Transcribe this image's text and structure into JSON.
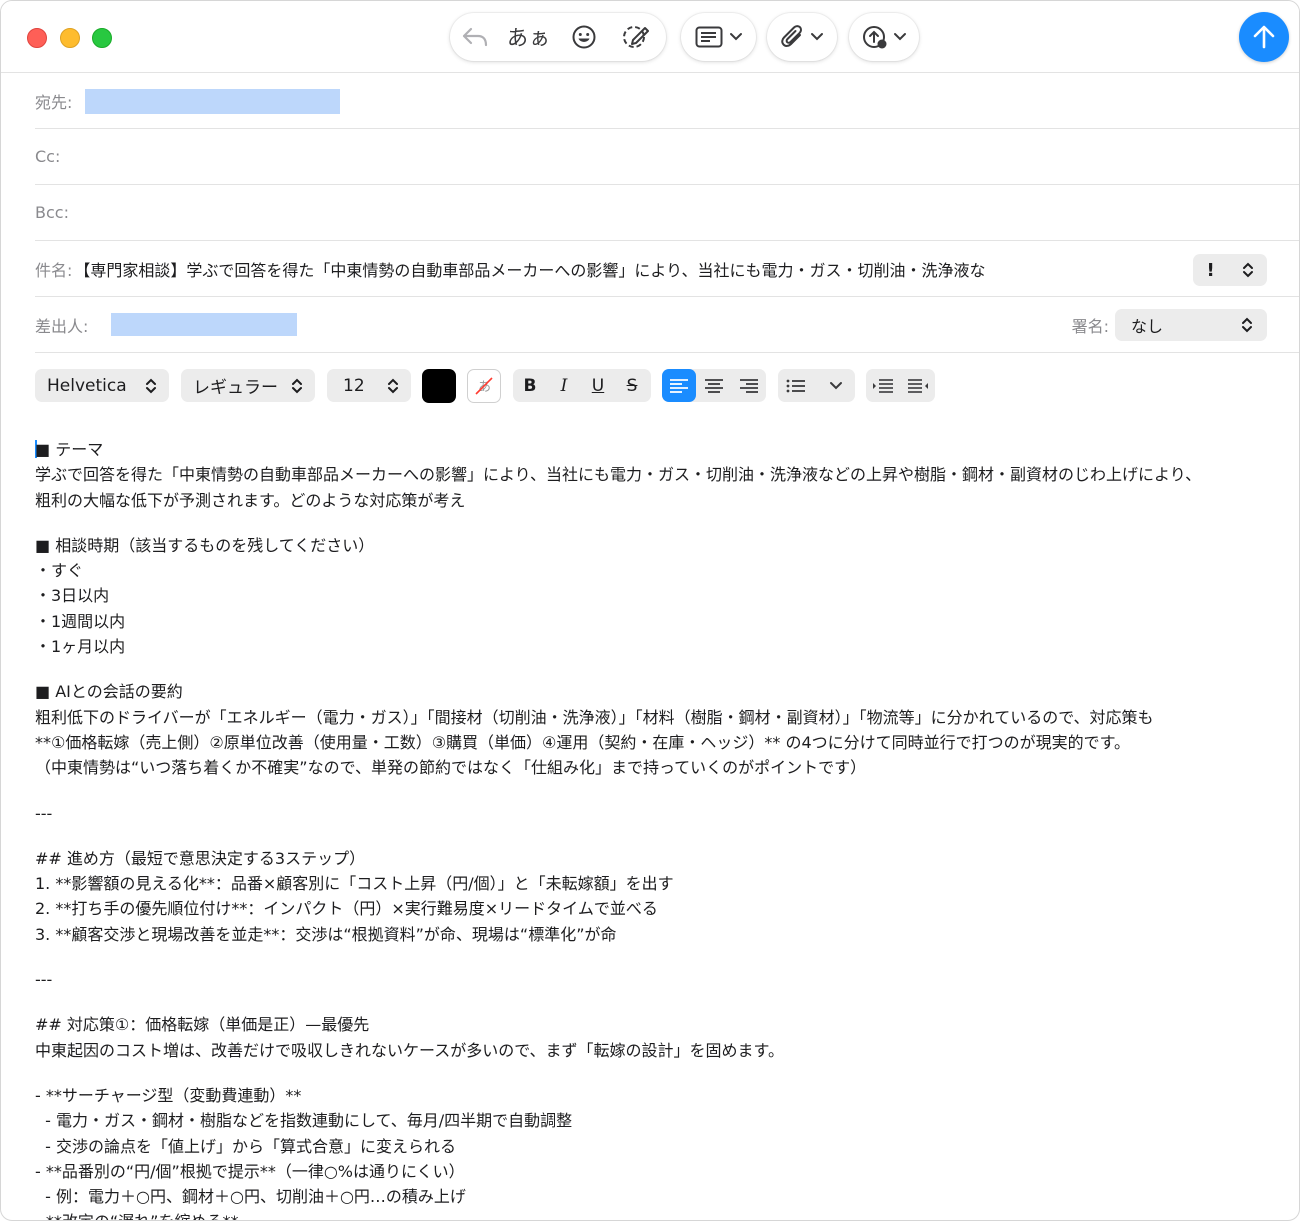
{
  "toolbar": {
    "format_label": "あぁ",
    "icons": [
      "reply-icon",
      "emoji-icon",
      "writing-tools-icon",
      "header-fields-icon",
      "attachment-icon",
      "photo-upload-icon",
      "send-icon"
    ]
  },
  "header": {
    "to_label": "宛先:",
    "cc_label": "Cc:",
    "bcc_label": "Bcc:",
    "subject_label": "件名:",
    "subject_value": "【専門家相談】学ぶで回答を得た「中東情勢の自動車部品メーカーへの影響」により、当社にも電力・ガス・切削油・洗浄液な",
    "priority_label": "!",
    "from_label": "差出人:",
    "signature_label": "署名:",
    "signature_value": "なし"
  },
  "format": {
    "font": "Helvetica",
    "style": "レギュラー",
    "size": "12",
    "bold": "B",
    "italic": "I",
    "underline": "U",
    "strike": "S",
    "text_color": "#000000"
  },
  "body": {
    "lines": [
      "■ テーマ",
      "学ぶで回答を得た「中東情勢の自動車部品メーカーへの影響」により、当社にも電力・ガス・切削油・洗浄液などの上昇や樹脂・鋼材・副資材のじわ上げにより、",
      "粗利の大幅な低下が予測されます。どのような対応策が考え",
      "",
      "■ 相談時期（該当するものを残してください）",
      "・すぐ",
      "・3日以内",
      "・1週間以内",
      "・1ヶ月以内",
      "",
      "■ AIとの会話の要約",
      "粗利低下のドライバーが「エネルギー（電力・ガス）」「間接材（切削油・洗浄液）」「材料（樹脂・鋼材・副資材）」「物流等」に分かれているので、対応策も",
      "**①価格転嫁（売上側）②原単位改善（使用量・工数）③購買（単価）④運用（契約・在庫・ヘッジ）** の4つに分けて同時並行で打つのが現実的です。",
      "（中東情勢は“いつ落ち着くか不確実”なので、単発の節約ではなく「仕組み化」まで持っていくのがポイントです）",
      "",
      "---",
      "",
      "## 進め方（最短で意思決定する3ステップ）",
      "1. **影響額の見える化**：品番×顧客別に「コスト上昇（円/個）」と「未転嫁額」を出す",
      "2. **打ち手の優先順位付け**：インパクト（円）×実行難易度×リードタイムで並べる",
      "3. **顧客交渉と現場改善を並走**：交渉は“根拠資料”が命、現場は“標準化”が命",
      "",
      "---",
      "",
      "## 対応策①：価格転嫁（単価是正）—最優先",
      "中東起因のコスト増は、改善だけで吸収しきれないケースが多いので、まず「転嫁の設計」を固めます。",
      "",
      "- **サーチャージ型（変動費連動）**",
      "  - 電力・ガス・鋼材・樹脂などを指数連動にして、毎月/四半期で自動調整",
      "  - 交渉の論点を「値上げ」から「算式合意」に変えられる",
      "- **品番別の“円/個”根拠で提示**（一律○%は通りにくい）",
      "  - 例：電力＋○円、鋼材＋○円、切削油＋○円…の積み上げ",
      "- **改定の“遅れ”を縮める**"
    ]
  }
}
